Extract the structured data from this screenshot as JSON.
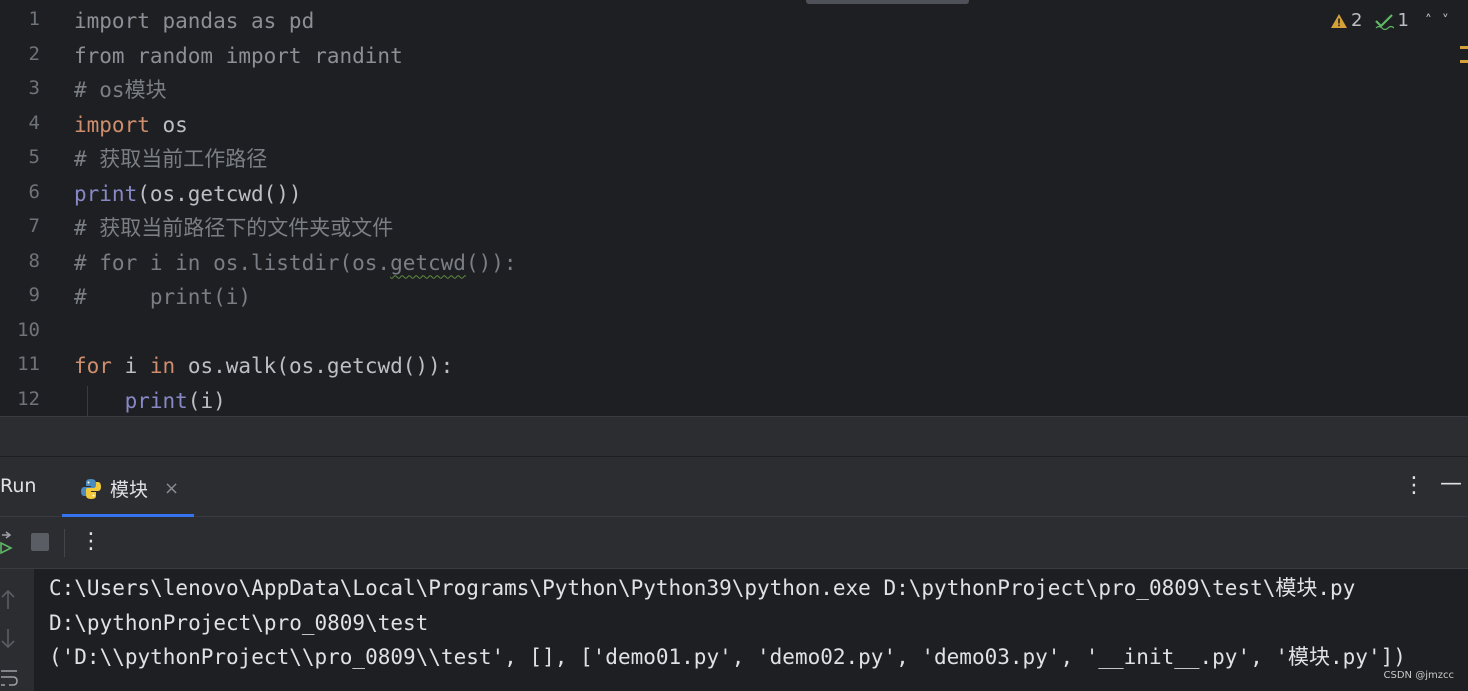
{
  "editor": {
    "lines": [
      {
        "number": "1",
        "parts": [
          {
            "t": "import pandas as pd",
            "c": "dim"
          }
        ]
      },
      {
        "number": "2",
        "parts": [
          {
            "t": "from random import randint",
            "c": "dim"
          }
        ]
      },
      {
        "number": "3",
        "parts": [
          {
            "t": "# os模块",
            "c": "cm"
          }
        ]
      },
      {
        "number": "4",
        "parts": [
          {
            "t": "import",
            "c": "kw"
          },
          {
            "t": " os",
            "c": "nm"
          }
        ]
      },
      {
        "number": "5",
        "parts": [
          {
            "t": "# 获取当前工作路径",
            "c": "cm"
          }
        ]
      },
      {
        "number": "6",
        "parts": [
          {
            "t": "print",
            "c": "fn"
          },
          {
            "t": "(os.getcwd())",
            "c": "nm"
          }
        ]
      },
      {
        "number": "7",
        "parts": [
          {
            "t": "# 获取当前路径下的文件夹或文件",
            "c": "cm"
          }
        ]
      },
      {
        "number": "8",
        "parts": [
          {
            "t": "# for i in os.listdir(os.",
            "c": "cm"
          },
          {
            "t": "getcwd",
            "c": "cm squiggle"
          },
          {
            "t": "()):",
            "c": "cm"
          }
        ]
      },
      {
        "number": "9",
        "parts": [
          {
            "t": "#     print(i)",
            "c": "cm"
          }
        ]
      },
      {
        "number": "10",
        "parts": []
      },
      {
        "number": "11",
        "parts": [
          {
            "t": "for",
            "c": "kw"
          },
          {
            "t": " i ",
            "c": "nm"
          },
          {
            "t": "in",
            "c": "kw"
          },
          {
            "t": " os.walk(os.getcwd()):",
            "c": "nm"
          }
        ]
      },
      {
        "number": "12",
        "parts": [
          {
            "t": "    ",
            "c": "nm"
          },
          {
            "t": "print",
            "c": "fn"
          },
          {
            "t": "(i)",
            "c": "nm"
          }
        ]
      }
    ],
    "inspections": {
      "warnings": "2",
      "weak_warnings": "1"
    }
  },
  "run_panel": {
    "title": "Run",
    "tab_label": "模块",
    "tab_close": "×",
    "more_icon": "⋮",
    "minimize_icon": "—"
  },
  "console": {
    "lines": [
      "C:\\Users\\lenovo\\AppData\\Local\\Programs\\Python\\Python39\\python.exe D:\\pythonProject\\pro_0809\\test\\模块.py",
      "D:\\pythonProject\\pro_0809\\test",
      "('D:\\\\pythonProject\\\\pro_0809\\\\test', [], ['demo01.py', 'demo02.py', 'demo03.py', '__init__.py', '模块.py'])"
    ]
  },
  "watermark": "CSDN @jmzcc",
  "colors": {
    "keyword": "#cf8e6d",
    "builtin": "#8888c6",
    "comment": "#7a7e85",
    "accent": "#3574f0",
    "warning": "#d6a039",
    "ok": "#5fb865"
  }
}
